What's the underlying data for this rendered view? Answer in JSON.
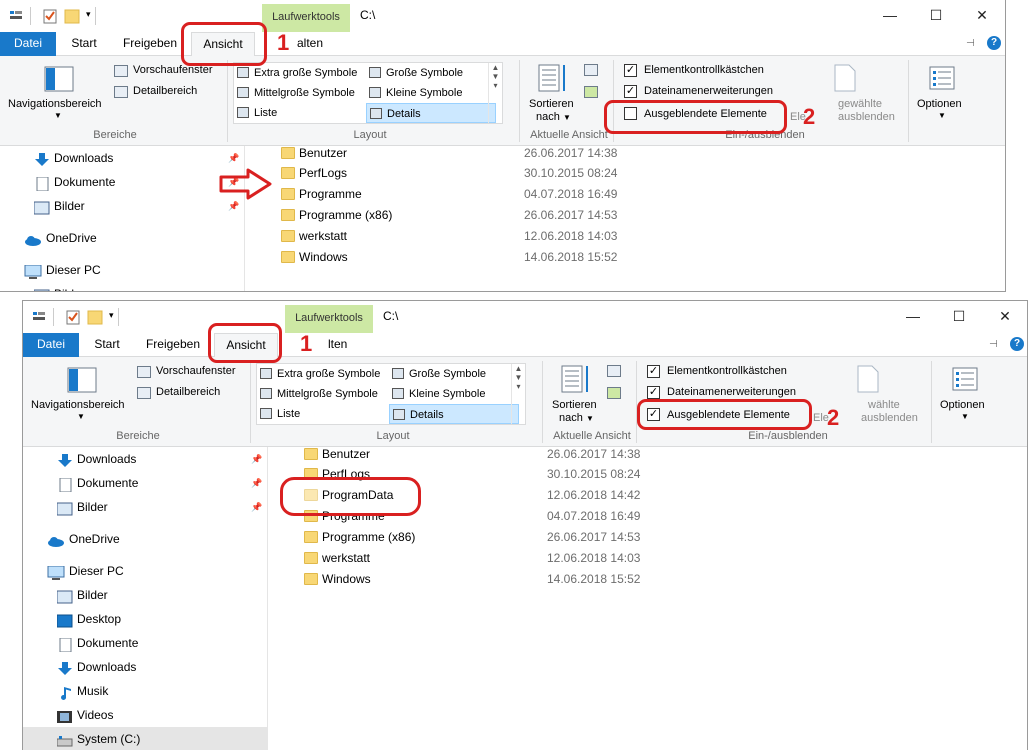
{
  "title": {
    "path": "C:\\",
    "context_tab": "Laufwerktools"
  },
  "window_controls": {
    "minimize": "—",
    "maximize": "☐",
    "close": "✕"
  },
  "tabs": {
    "datei": "Datei",
    "start": "Start",
    "freigeben": "Freigeben",
    "ansicht": "Ansicht",
    "verwalten_top": "Verwalten",
    "verwalten_bottom": "Verwalten",
    "verwalten_top_visible": "alten",
    "verwalten_bottom_visible": "lten"
  },
  "help": "?",
  "ribbon": {
    "bereiche": {
      "navigationsbereich": "Navigationsbereich",
      "vorschaufenster": "Vorschaufenster",
      "detailbereich": "Detailbereich",
      "label": "Bereiche"
    },
    "layout": {
      "items": [
        "Extra große Symbole",
        "Große Symbole",
        "Mittelgroße Symbole",
        "Kleine Symbole",
        "Liste",
        "Details"
      ],
      "selected": "Details",
      "label": "Layout"
    },
    "aktuelle_ansicht": {
      "sortieren": "Sortieren",
      "nach": "nach",
      "label": "Aktuelle Ansicht"
    },
    "ein_ausblenden": {
      "elementkontrollkaestchen": "Elementkontrollkästchen",
      "dateinamenerweiterungen": "Dateinamenerweiterungen",
      "ausgeblendete_elemente": "Ausgeblendete Elemente",
      "ausgewaehlte_top": "Ele",
      "ausgewaehlte_top2": "gewählte",
      "ausblenden_top": "ausblenden",
      "ausgewaehlte_bottom": "Ele",
      "ausgewaehlte_bottom2": "wählte",
      "ausblenden_bottom": "ausblenden",
      "label_top": "Ein-/ausblenden",
      "label_bottom": "Ein-/ausblenden",
      "label_top_visible": "Ein-/ausblenden"
    },
    "optionen": "Optionen"
  },
  "top_window": {
    "checks": {
      "elementkontrollkaestchen": true,
      "dateinamenerweiterungen": true,
      "ausgeblendete_elemente": false
    },
    "nav": [
      "Downloads",
      "Dokumente",
      "Bilder",
      "OneDrive",
      "Dieser PC",
      "Bilder"
    ],
    "files": [
      {
        "name": "Benutzer",
        "date": "26.06.2017 14:38"
      },
      {
        "name": "PerfLogs",
        "date": "30.10.2015 08:24"
      },
      {
        "name": "Programme",
        "date": "04.07.2018 16:49"
      },
      {
        "name": "Programme (x86)",
        "date": "26.06.2017 14:53"
      },
      {
        "name": "werkstatt",
        "date": "12.06.2018 14:03"
      },
      {
        "name": "Windows",
        "date": "14.06.2018 15:52"
      }
    ]
  },
  "bottom_window": {
    "checks": {
      "elementkontrollkaestchen": true,
      "dateinamenerweiterungen": true,
      "ausgeblendete_elemente": true
    },
    "nav": [
      "Downloads",
      "Dokumente",
      "Bilder",
      "OneDrive",
      "Dieser PC",
      "Bilder",
      "Desktop",
      "Dokumente",
      "Downloads",
      "Musik",
      "Videos",
      "System (C:)"
    ],
    "files": [
      {
        "name": "Benutzer",
        "date": "26.06.2017 14:38"
      },
      {
        "name": "PerfLogs",
        "date": "30.10.2015 08:24"
      },
      {
        "name": "ProgramData",
        "date": "12.06.2018 14:42"
      },
      {
        "name": "Programme",
        "date": "04.07.2018 16:49"
      },
      {
        "name": "Programme (x86)",
        "date": "26.06.2017 14:53"
      },
      {
        "name": "werkstatt",
        "date": "12.06.2018 14:03"
      },
      {
        "name": "Windows",
        "date": "14.06.2018 15:52"
      }
    ]
  },
  "annotations": {
    "step1": "1",
    "step2": "2"
  },
  "colors": {
    "accent": "#1979ca",
    "annotation": "#d92020",
    "context_tab": "#cde8a4",
    "folder": "#f8d775"
  }
}
